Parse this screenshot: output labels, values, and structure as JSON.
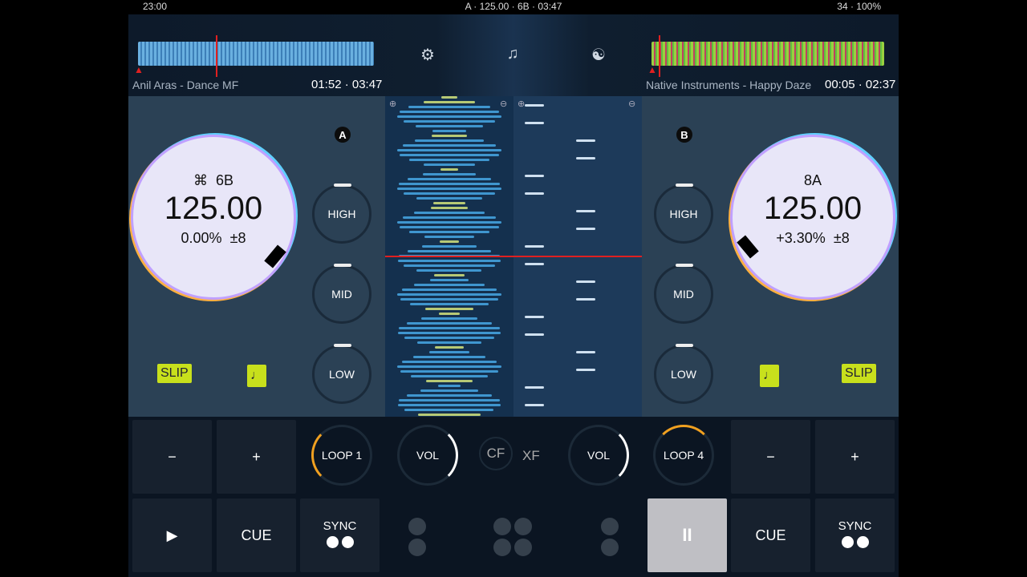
{
  "status": {
    "time": "23:00",
    "center": "A · 125.00 · 6B · 03:47",
    "right": "34 · 100%"
  },
  "deck_a": {
    "track": "Anil Aras - Dance MF",
    "time": "01:52 · 03:47",
    "label": "A",
    "key_icon": "⌘",
    "key": "6B",
    "bpm": "125.00",
    "pitch": "0.00%",
    "range": "±8",
    "slip": "SLIP",
    "note": "♩",
    "eq": [
      "HIGH",
      "MID",
      "LOW"
    ],
    "loop": "LOOP 1",
    "vol": "VOL",
    "minus": "−",
    "plus": "+",
    "play": "▶",
    "cue": "CUE",
    "sync": "SYNC"
  },
  "deck_b": {
    "track": "Native Instruments - Happy Daze",
    "time": "00:05 · 02:37",
    "label": "B",
    "key": "8A",
    "bpm": "125.00",
    "pitch": "+3.30%",
    "range": "±8",
    "slip": "SLIP",
    "note": "♩",
    "eq": [
      "HIGH",
      "MID",
      "LOW"
    ],
    "loop": "LOOP 4",
    "vol": "VOL",
    "minus": "−",
    "plus": "+",
    "pause": "II",
    "cue": "CUE",
    "sync": "SYNC"
  },
  "toolbar": {
    "settings": "⚙",
    "music": "♫",
    "fx": "☯"
  },
  "mixer": {
    "cf": "CF",
    "xf": "XF"
  },
  "colors": {
    "deck_panel": "#2b4155",
    "accent": "#c8e01c",
    "loop_active": "#f0a020",
    "playhead": "#e02020"
  }
}
